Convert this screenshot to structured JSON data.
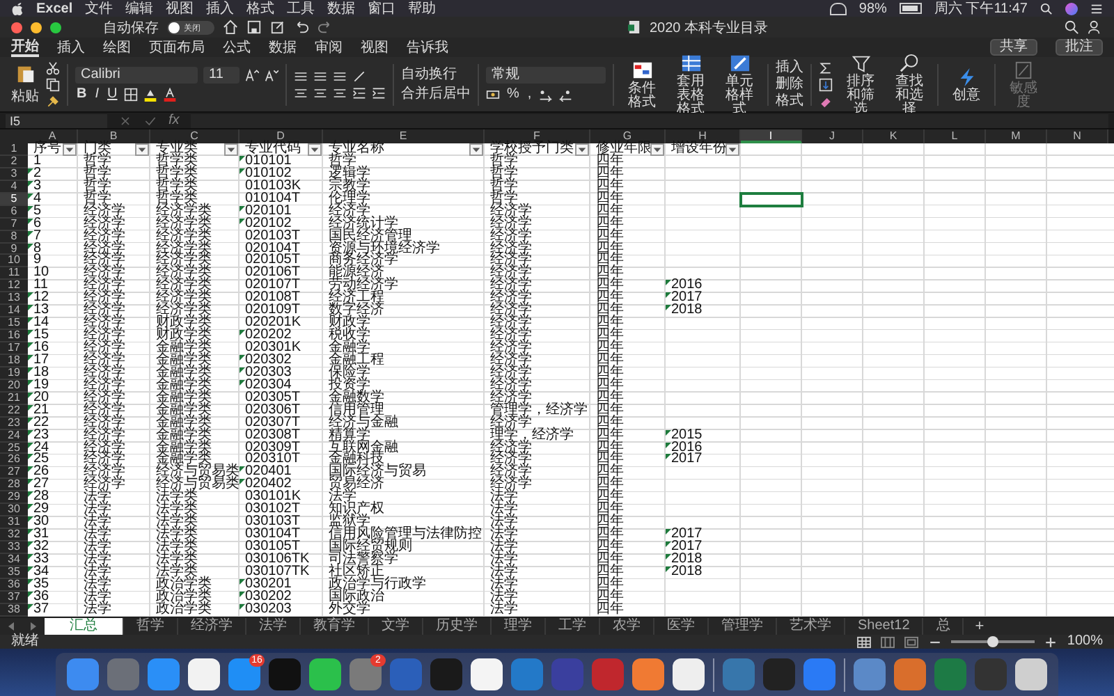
{
  "menubar": {
    "app": "Excel",
    "items": [
      "文件",
      "编辑",
      "视图",
      "插入",
      "格式",
      "工具",
      "数据",
      "窗口",
      "帮助"
    ],
    "battery": "98%",
    "clock": "周六 下午11:47"
  },
  "titlebar": {
    "autosave_label": "自动保存",
    "autosave_state": "关闭",
    "autosave_on": false,
    "title": "2020 本科专业目录"
  },
  "ribbon_tabs": [
    {
      "label": "开始",
      "selected": true
    },
    {
      "label": "插入",
      "selected": false
    },
    {
      "label": "绘图",
      "selected": false
    },
    {
      "label": "页面布局",
      "selected": false
    },
    {
      "label": "公式",
      "selected": false
    },
    {
      "label": "数据",
      "selected": false
    },
    {
      "label": "审阅",
      "selected": false
    },
    {
      "label": "视图",
      "selected": false
    },
    {
      "label": "告诉我",
      "selected": false
    }
  ],
  "share": "共享",
  "comments": "批注",
  "ribbon": {
    "paste": "粘贴",
    "font": "Calibri",
    "size": "11",
    "bold": "B",
    "italic": "I",
    "underline": "U",
    "wrap": "自动换行",
    "merge": "合并后居中",
    "number_format": "常规",
    "percent": "%",
    "comma": ",",
    "cond_format": "条件格式",
    "table_format": "套用表格格式",
    "cell_style": "单元格样式",
    "insert": "插入",
    "delete": "删除",
    "format": "格式",
    "sort": "排序和筛选",
    "find": "查找和选择",
    "ideas": "创意",
    "sensitivity": "敏感度"
  },
  "name_box": "I5",
  "formula_label": "fx",
  "columns": [
    {
      "letter": "A",
      "selected": false
    },
    {
      "letter": "B",
      "selected": false
    },
    {
      "letter": "C",
      "selected": false
    },
    {
      "letter": "D",
      "selected": false
    },
    {
      "letter": "E",
      "selected": false
    },
    {
      "letter": "F",
      "selected": false
    },
    {
      "letter": "G",
      "selected": false
    },
    {
      "letter": "H",
      "selected": false
    },
    {
      "letter": "I",
      "selected": true
    },
    {
      "letter": "J",
      "selected": false
    },
    {
      "letter": "K",
      "selected": false
    },
    {
      "letter": "L",
      "selected": false
    },
    {
      "letter": "M",
      "selected": false
    },
    {
      "letter": "N",
      "selected": false
    }
  ],
  "rows": [
    {
      "n": "1",
      "kind": "header",
      "selected": false,
      "a_flag": false,
      "d_flag": false,
      "h_flag": false,
      "cells": [
        "序号",
        "门类",
        "专业类",
        "专业代码",
        "专业名称",
        "学校授予门类",
        "修业年限",
        "增设年份"
      ]
    },
    {
      "n": "2",
      "kind": "data",
      "selected": false,
      "a_flag": false,
      "d_flag": true,
      "h_flag": false,
      "cells": [
        "1",
        "哲学",
        "哲学类",
        "010101",
        "哲学",
        "哲学",
        "四年",
        ""
      ]
    },
    {
      "n": "3",
      "kind": "data",
      "selected": false,
      "a_flag": true,
      "d_flag": true,
      "h_flag": false,
      "cells": [
        "2",
        "哲学",
        "哲学类",
        "010102",
        "逻辑学",
        "哲学",
        "四年",
        ""
      ]
    },
    {
      "n": "4",
      "kind": "data",
      "selected": false,
      "a_flag": true,
      "d_flag": false,
      "h_flag": false,
      "cells": [
        "3",
        "哲学",
        "哲学类",
        "010103K",
        "宗教学",
        "哲学",
        "四年",
        ""
      ]
    },
    {
      "n": "5",
      "kind": "data",
      "selected": true,
      "a_flag": true,
      "d_flag": false,
      "h_flag": false,
      "cells": [
        "4",
        "哲学",
        "哲学类",
        "010104T",
        "伦理学",
        "哲学",
        "四年",
        ""
      ]
    },
    {
      "n": "6",
      "kind": "data",
      "selected": false,
      "a_flag": true,
      "d_flag": true,
      "h_flag": false,
      "cells": [
        "5",
        "经济学",
        "经济学类",
        "020101",
        "经济学",
        "经济学",
        "四年",
        ""
      ]
    },
    {
      "n": "7",
      "kind": "data",
      "selected": false,
      "a_flag": true,
      "d_flag": true,
      "h_flag": false,
      "cells": [
        "6",
        "经济学",
        "经济学类",
        "020102",
        "经济统计学",
        "经济学",
        "四年",
        ""
      ]
    },
    {
      "n": "8",
      "kind": "data",
      "selected": false,
      "a_flag": true,
      "d_flag": false,
      "h_flag": false,
      "cells": [
        "7",
        "经济学",
        "经济学类",
        "020103T",
        "国民经济管理",
        "经济学",
        "四年",
        ""
      ]
    },
    {
      "n": "9",
      "kind": "data",
      "selected": false,
      "a_flag": true,
      "d_flag": false,
      "h_flag": false,
      "cells": [
        "8",
        "经济学",
        "经济学类",
        "020104T",
        "资源与环境经济学",
        "经济学",
        "四年",
        ""
      ]
    },
    {
      "n": "10",
      "kind": "data",
      "selected": false,
      "a_flag": false,
      "d_flag": false,
      "h_flag": false,
      "cells": [
        "9",
        "经济学",
        "经济学类",
        "020105T",
        "商务经济学",
        "经济学",
        "四年",
        ""
      ]
    },
    {
      "n": "11",
      "kind": "data",
      "selected": false,
      "a_flag": false,
      "d_flag": false,
      "h_flag": false,
      "cells": [
        "10",
        "经济学",
        "经济学类",
        "020106T",
        "能源经济",
        "经济学",
        "四年",
        ""
      ]
    },
    {
      "n": "12",
      "kind": "data",
      "selected": false,
      "a_flag": false,
      "d_flag": false,
      "h_flag": true,
      "cells": [
        "11",
        "经济学",
        "经济学类",
        "020107T",
        "劳动经济学",
        "经济学",
        "四年",
        "2016"
      ]
    },
    {
      "n": "13",
      "kind": "data",
      "selected": false,
      "a_flag": true,
      "d_flag": false,
      "h_flag": true,
      "cells": [
        "12",
        "经济学",
        "经济学类",
        "020108T",
        "经济工程",
        "经济学",
        "四年",
        "2017"
      ]
    },
    {
      "n": "14",
      "kind": "data",
      "selected": false,
      "a_flag": true,
      "d_flag": false,
      "h_flag": true,
      "cells": [
        "13",
        "经济学",
        "经济学类",
        "020109T",
        "数字经济",
        "经济学",
        "四年",
        "2018"
      ]
    },
    {
      "n": "15",
      "kind": "data",
      "selected": false,
      "a_flag": true,
      "d_flag": false,
      "h_flag": false,
      "cells": [
        "14",
        "经济学",
        "财政学类",
        "020201K",
        "财政学",
        "经济学",
        "四年",
        ""
      ]
    },
    {
      "n": "16",
      "kind": "data",
      "selected": false,
      "a_flag": true,
      "d_flag": true,
      "h_flag": false,
      "cells": [
        "15",
        "经济学",
        "财政学类",
        "020202",
        "税收学",
        "经济学",
        "四年",
        ""
      ]
    },
    {
      "n": "17",
      "kind": "data",
      "selected": false,
      "a_flag": true,
      "d_flag": false,
      "h_flag": false,
      "cells": [
        "16",
        "经济学",
        "金融学类",
        "020301K",
        "金融学",
        "经济学",
        "四年",
        ""
      ]
    },
    {
      "n": "18",
      "kind": "data",
      "selected": false,
      "a_flag": true,
      "d_flag": true,
      "h_flag": false,
      "cells": [
        "17",
        "经济学",
        "金融学类",
        "020302",
        "金融工程",
        "经济学",
        "四年",
        ""
      ]
    },
    {
      "n": "19",
      "kind": "data",
      "selected": false,
      "a_flag": true,
      "d_flag": true,
      "h_flag": false,
      "cells": [
        "18",
        "经济学",
        "金融学类",
        "020303",
        "保险学",
        "经济学",
        "四年",
        ""
      ]
    },
    {
      "n": "20",
      "kind": "data",
      "selected": false,
      "a_flag": true,
      "d_flag": true,
      "h_flag": false,
      "cells": [
        "19",
        "经济学",
        "金融学类",
        "020304",
        "投资学",
        "经济学",
        "四年",
        ""
      ]
    },
    {
      "n": "21",
      "kind": "data",
      "selected": false,
      "a_flag": true,
      "d_flag": false,
      "h_flag": false,
      "cells": [
        "20",
        "经济学",
        "金融学类",
        "020305T",
        "金融数学",
        "经济学",
        "四年",
        ""
      ]
    },
    {
      "n": "22",
      "kind": "data",
      "selected": false,
      "a_flag": true,
      "d_flag": false,
      "h_flag": false,
      "cells": [
        "21",
        "经济学",
        "金融学类",
        "020306T",
        "信用管理",
        "管理学，经济学",
        "四年",
        ""
      ]
    },
    {
      "n": "23",
      "kind": "data",
      "selected": false,
      "a_flag": true,
      "d_flag": false,
      "h_flag": false,
      "cells": [
        "22",
        "经济学",
        "金融学类",
        "020307T",
        "经济与金融",
        "经济学",
        "四年",
        ""
      ]
    },
    {
      "n": "24",
      "kind": "data",
      "selected": false,
      "a_flag": true,
      "d_flag": false,
      "h_flag": true,
      "cells": [
        "23",
        "经济学",
        "金融学类",
        "020308T",
        "精算学",
        "理学，经济学",
        "四年",
        "2015"
      ]
    },
    {
      "n": "25",
      "kind": "data",
      "selected": false,
      "a_flag": true,
      "d_flag": false,
      "h_flag": true,
      "cells": [
        "24",
        "经济学",
        "金融学类",
        "020309T",
        "互联网金融",
        "经济学",
        "四年",
        "2016"
      ]
    },
    {
      "n": "26",
      "kind": "data",
      "selected": false,
      "a_flag": true,
      "d_flag": false,
      "h_flag": true,
      "cells": [
        "25",
        "经济学",
        "金融学类",
        "020310T",
        "金融科技",
        "经济学",
        "四年",
        "2017"
      ]
    },
    {
      "n": "27",
      "kind": "data",
      "selected": false,
      "a_flag": true,
      "d_flag": true,
      "h_flag": false,
      "cells": [
        "26",
        "经济学",
        "经济与贸易类",
        "020401",
        "国际经济与贸易",
        "经济学",
        "四年",
        ""
      ]
    },
    {
      "n": "28",
      "kind": "data",
      "selected": false,
      "a_flag": true,
      "d_flag": true,
      "h_flag": false,
      "cells": [
        "27",
        "经济学",
        "经济与贸易类",
        "020402",
        "贸易经济",
        "经济学",
        "四年",
        ""
      ]
    },
    {
      "n": "29",
      "kind": "data",
      "selected": false,
      "a_flag": true,
      "d_flag": false,
      "h_flag": false,
      "cells": [
        "28",
        "法学",
        "法学类",
        "030101K",
        "法学",
        "法学",
        "四年",
        ""
      ]
    },
    {
      "n": "30",
      "kind": "data",
      "selected": false,
      "a_flag": true,
      "d_flag": false,
      "h_flag": false,
      "cells": [
        "29",
        "法学",
        "法学类",
        "030102T",
        "知识产权",
        "法学",
        "四年",
        ""
      ]
    },
    {
      "n": "31",
      "kind": "data",
      "selected": false,
      "a_flag": true,
      "d_flag": false,
      "h_flag": false,
      "cells": [
        "30",
        "法学",
        "法学类",
        "030103T",
        "监狱学",
        "法学",
        "四年",
        ""
      ]
    },
    {
      "n": "32",
      "kind": "data",
      "selected": false,
      "a_flag": true,
      "d_flag": false,
      "h_flag": true,
      "cells": [
        "31",
        "法学",
        "法学类",
        "030104T",
        "信用风险管理与法律防控",
        "法学",
        "四年",
        "2017"
      ]
    },
    {
      "n": "33",
      "kind": "data",
      "selected": false,
      "a_flag": true,
      "d_flag": false,
      "h_flag": true,
      "cells": [
        "32",
        "法学",
        "法学类",
        "030105T",
        "国际经贸规则",
        "法学",
        "四年",
        "2017"
      ]
    },
    {
      "n": "34",
      "kind": "data",
      "selected": false,
      "a_flag": true,
      "d_flag": false,
      "h_flag": true,
      "cells": [
        "33",
        "法学",
        "法学类",
        "030106TK",
        "司法警察学",
        "法学",
        "四年",
        "2018"
      ]
    },
    {
      "n": "35",
      "kind": "data",
      "selected": false,
      "a_flag": true,
      "d_flag": false,
      "h_flag": true,
      "cells": [
        "34",
        "法学",
        "法学类",
        "030107TK",
        "社区矫正",
        "法学",
        "四年",
        "2018"
      ]
    },
    {
      "n": "36",
      "kind": "data",
      "selected": false,
      "a_flag": true,
      "d_flag": true,
      "h_flag": false,
      "cells": [
        "35",
        "法学",
        "政治学类",
        "030201",
        "政治学与行政学",
        "法学",
        "四年",
        ""
      ]
    },
    {
      "n": "37",
      "kind": "data",
      "selected": false,
      "a_flag": true,
      "d_flag": true,
      "h_flag": false,
      "cells": [
        "36",
        "法学",
        "政治学类",
        "030202",
        "国际政治",
        "法学",
        "四年",
        ""
      ]
    },
    {
      "n": "38",
      "kind": "data",
      "selected": false,
      "a_flag": true,
      "d_flag": true,
      "h_flag": false,
      "cells": [
        "37",
        "法学",
        "政治学类",
        "030203",
        "外交学",
        "法学",
        "四年",
        ""
      ]
    }
  ],
  "sheet_tabs": [
    {
      "label": "汇总",
      "selected": true
    },
    {
      "label": "哲学",
      "selected": false
    },
    {
      "label": "经济学",
      "selected": false
    },
    {
      "label": "法学",
      "selected": false
    },
    {
      "label": "教育学",
      "selected": false
    },
    {
      "label": "文学",
      "selected": false
    },
    {
      "label": "历史学",
      "selected": false
    },
    {
      "label": "理学",
      "selected": false
    },
    {
      "label": "工学",
      "selected": false
    },
    {
      "label": "农学",
      "selected": false
    },
    {
      "label": "医学",
      "selected": false
    },
    {
      "label": "管理学",
      "selected": false
    },
    {
      "label": "艺术学",
      "selected": false
    },
    {
      "label": "Sheet12",
      "selected": false
    },
    {
      "label": "总",
      "selected": false
    }
  ],
  "add_sheet": "+",
  "status": {
    "text": "就绪",
    "zoom": "100%",
    "zoom_slider": {
      "level": 0.5
    }
  },
  "dock_badges": [
    "16",
    "2"
  ]
}
